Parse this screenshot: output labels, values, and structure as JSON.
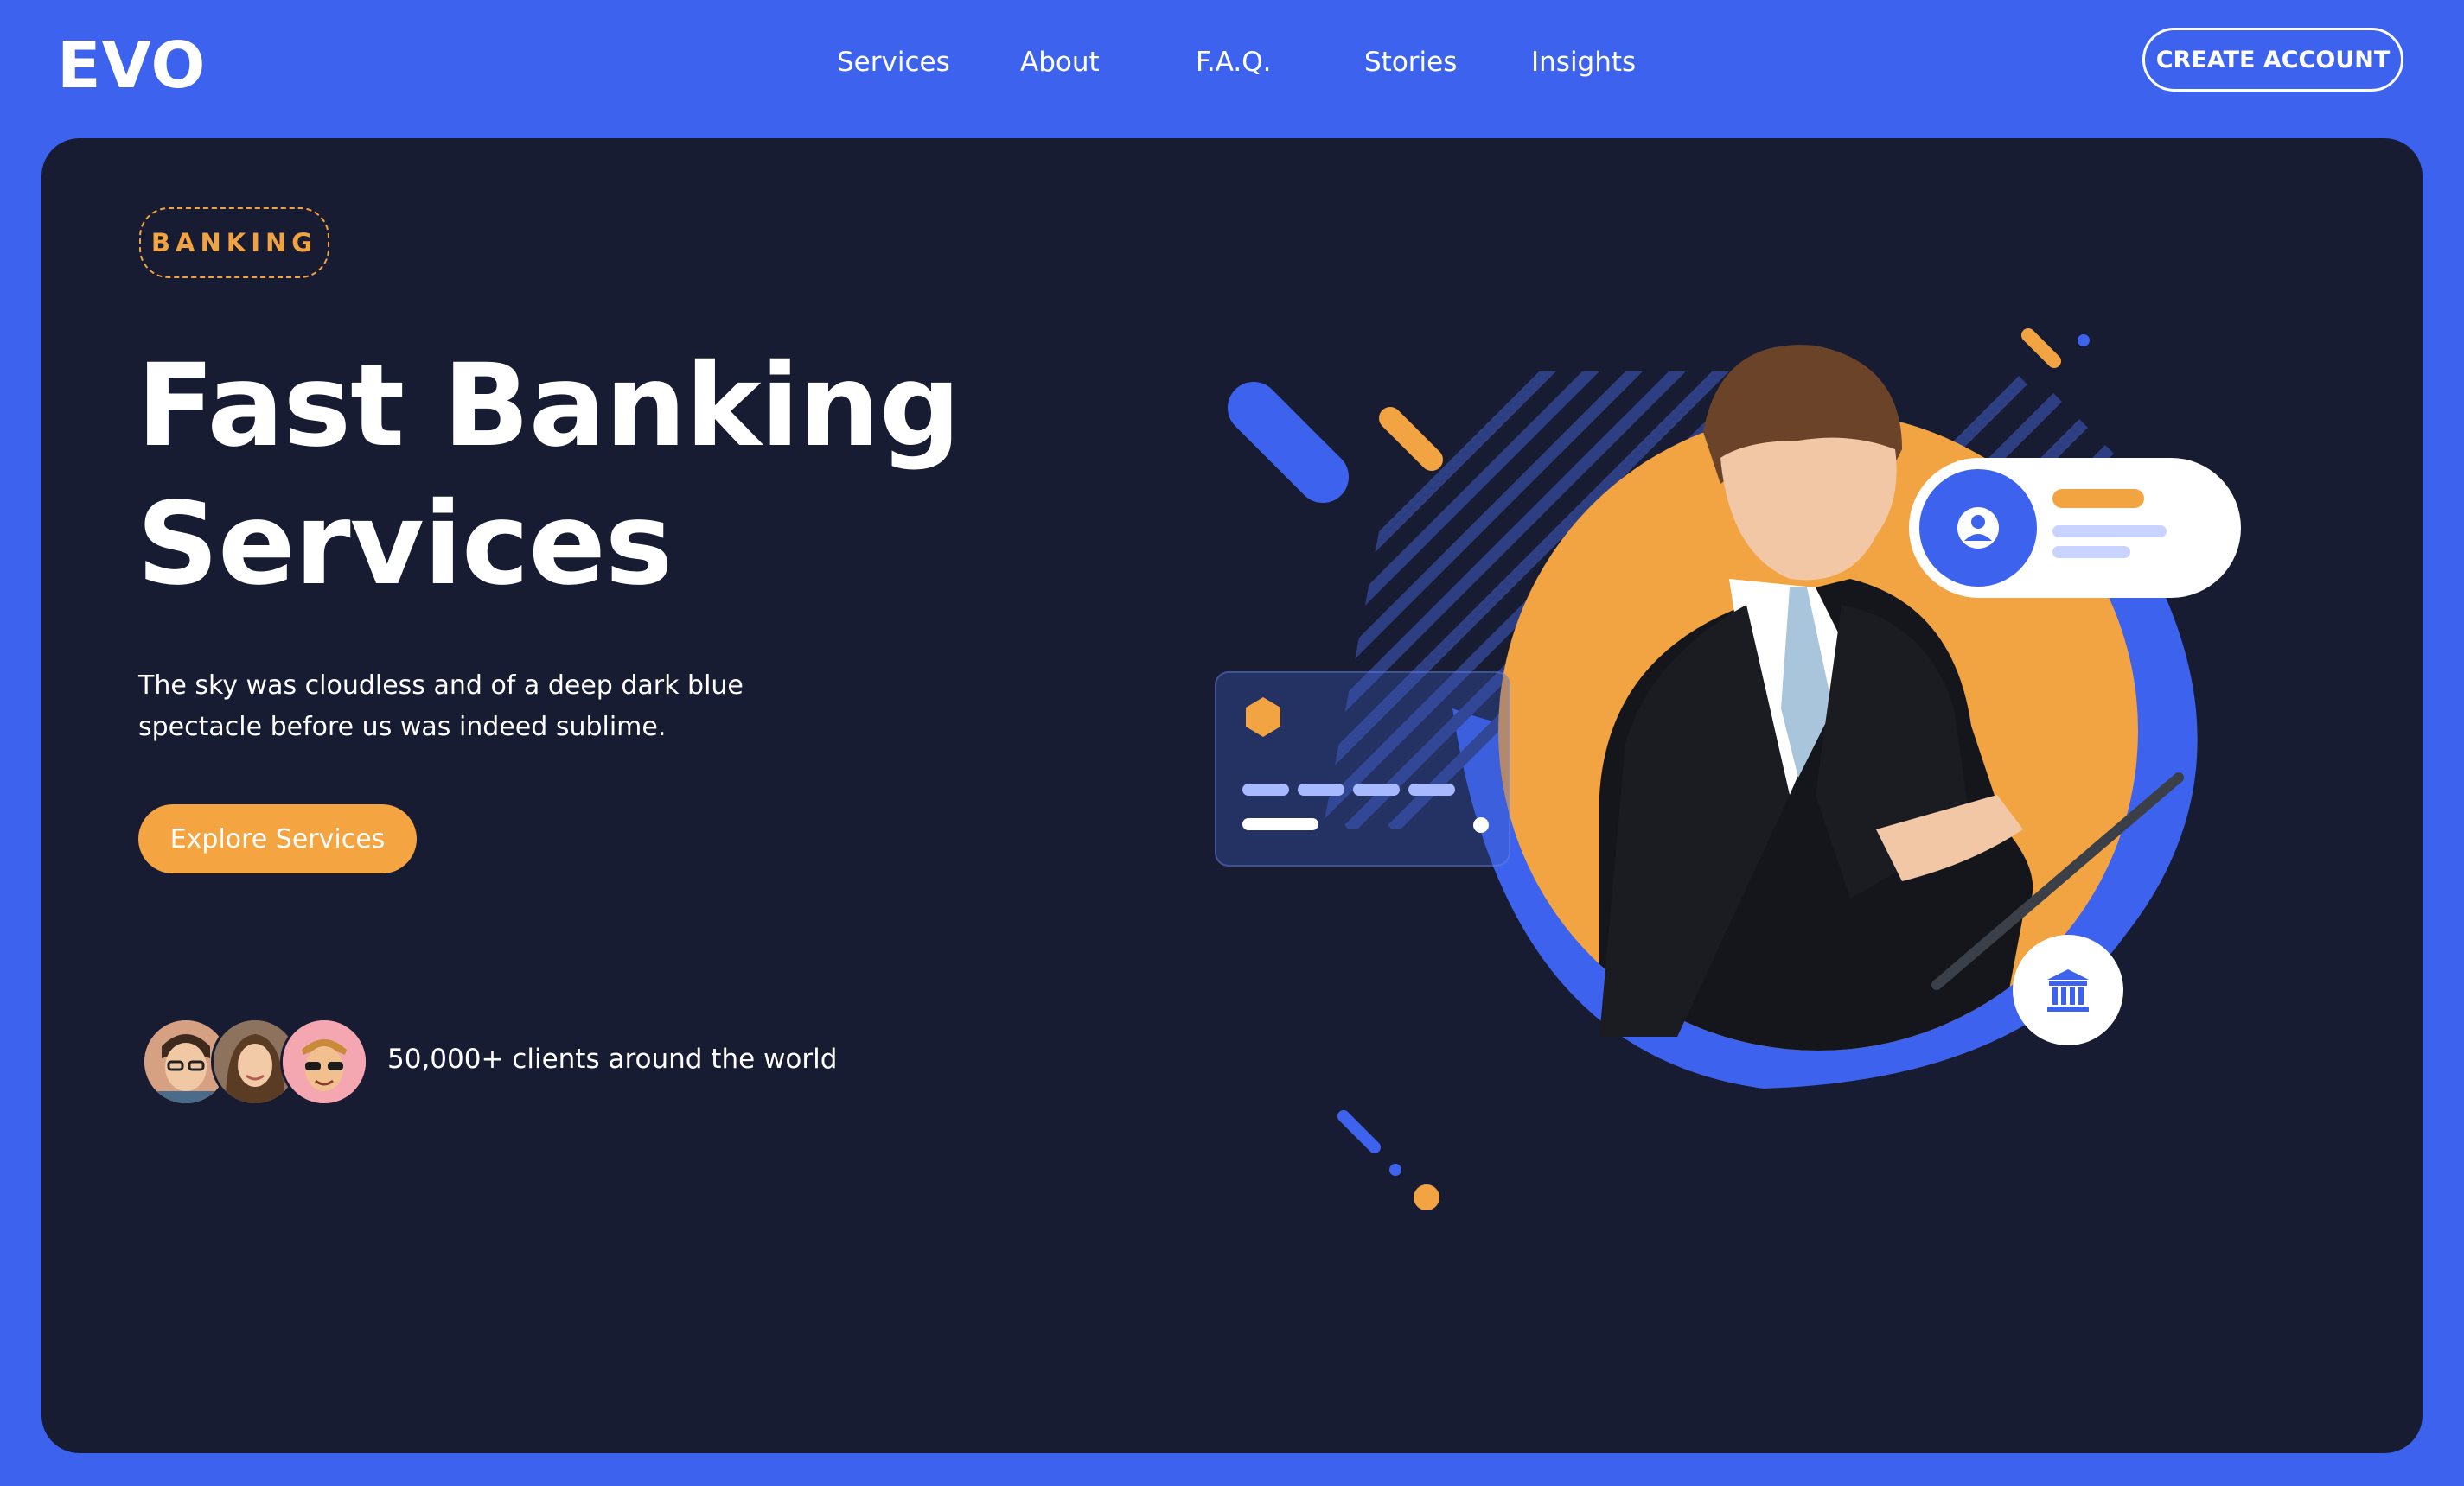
{
  "header": {
    "logo": "EVO",
    "nav": [
      {
        "label": "Services"
      },
      {
        "label": "About"
      },
      {
        "label": "F.A.Q."
      },
      {
        "label": "Stories"
      },
      {
        "label": "Insights"
      }
    ],
    "cta_label": "CREATE ACCOUNT"
  },
  "hero": {
    "tag": "BANKING",
    "headline_line1": "Fast Banking",
    "headline_line2": "Services",
    "description_line1": "The sky was cloudless and of a deep dark blue",
    "description_line2": "spectacle before us was indeed sublime.",
    "button_label": "Explore Services",
    "clients_text": "50,000+ clients around the world"
  },
  "colors": {
    "brand_blue": "#3d63ee",
    "panel_navy": "#181c33",
    "accent_orange": "#f5a442"
  },
  "icons": {
    "profile": "user-circle-icon",
    "bank": "bank-building-icon",
    "card_chip": "hexagon-chip-icon"
  }
}
